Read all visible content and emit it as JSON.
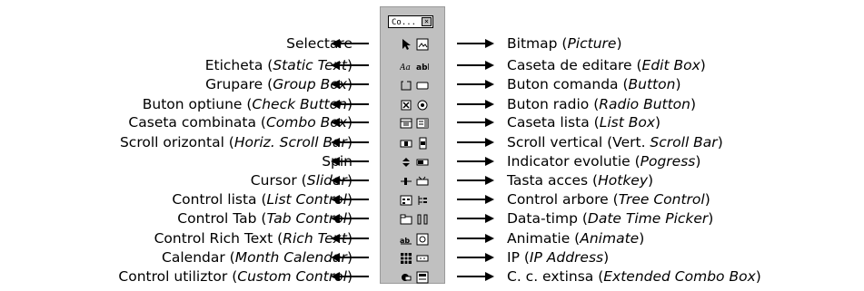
{
  "toolbox": {
    "title": "Co...",
    "close": "×"
  },
  "left_labels": [
    {
      "plain": "Selectare",
      "italic": "",
      "suffix": ""
    },
    {
      "plain": "Eticheta (",
      "italic": "Static Text",
      "suffix": ")"
    },
    {
      "plain": "Grupare (",
      "italic": "Group Box",
      "suffix": ")"
    },
    {
      "plain": "Buton optiune (",
      "italic": "Check Button",
      "suffix": ")"
    },
    {
      "plain": "Caseta combinata (",
      "italic": "Combo Box",
      "suffix": ")"
    },
    {
      "plain": "Scroll orizontal (",
      "italic": "Horiz. Scroll Bar",
      "suffix": ")"
    },
    {
      "plain": "Spin",
      "italic": "",
      "suffix": ""
    },
    {
      "plain": "Cursor (",
      "italic": "Slider",
      "suffix": ")"
    },
    {
      "plain": "Control lista (",
      "italic": "List Control",
      "suffix": ")"
    },
    {
      "plain": "Control Tab (",
      "italic": "Tab Control",
      "suffix": ")"
    },
    {
      "plain": "Control Rich Text (",
      "italic": "Rich Text",
      "suffix": ")"
    },
    {
      "plain": "Calendar (",
      "italic": "Month Calendar",
      "suffix": ")"
    },
    {
      "plain": "Control utiliztor (",
      "italic": "Custom Control",
      "suffix": ")"
    }
  ],
  "right_labels": [
    {
      "plain": "Bitmap (",
      "italic": "Picture",
      "suffix": ")"
    },
    {
      "plain": "Caseta de editare (",
      "italic": "Edit Box",
      "suffix": ")"
    },
    {
      "plain": "Buton comanda (",
      "italic": "Button",
      "suffix": ")"
    },
    {
      "plain": "Buton radio (",
      "italic": "Radio Button",
      "suffix": ")"
    },
    {
      "plain": "Caseta lista (",
      "italic": "List Box",
      "suffix": ")"
    },
    {
      "plain": "Scroll vertical (Vert. ",
      "italic": "Scroll Bar",
      "suffix": ")"
    },
    {
      "plain": "Indicator evolutie (",
      "italic": "Pogress",
      "suffix": ")"
    },
    {
      "plain": "Tasta acces (",
      "italic": "Hotkey",
      "suffix": ")"
    },
    {
      "plain": "Control arbore (",
      "italic": "Tree Control",
      "suffix": ")"
    },
    {
      "plain": "Data-timp (",
      "italic": "Date Time Picker",
      "suffix": ")"
    },
    {
      "plain": "Animatie (",
      "italic": "Animate",
      "suffix": ")"
    },
    {
      "plain": "IP (",
      "italic": "IP Address",
      "suffix": ")"
    },
    {
      "plain": "C. c. extinsa (",
      "italic": "Extended Combo Box",
      "suffix": ")"
    }
  ],
  "left_icons": [
    "pointer-icon",
    "static-text-icon",
    "group-box-icon",
    "check-box-icon",
    "combo-box-icon",
    "hscroll-icon",
    "spin-icon",
    "slider-icon",
    "list-control-icon",
    "tab-control-icon",
    "rich-text-icon",
    "month-calendar-icon",
    "custom-control-icon"
  ],
  "right_icons": [
    "picture-icon",
    "edit-box-icon",
    "button-icon",
    "radio-button-icon",
    "list-box-icon",
    "vscroll-icon",
    "progress-icon",
    "hotkey-icon",
    "tree-control-icon",
    "date-time-icon",
    "animate-icon",
    "ip-address-icon",
    "extended-combo-icon"
  ]
}
